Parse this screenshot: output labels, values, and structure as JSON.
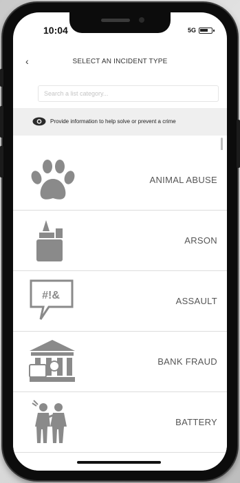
{
  "status_bar": {
    "time": "10:04",
    "signal": "5G"
  },
  "header": {
    "back_glyph": "‹",
    "title": "SELECT AN INCIDENT TYPE"
  },
  "search": {
    "placeholder": "Search a list category..."
  },
  "notice": {
    "text": "Provide information to help solve or prevent a crime",
    "icon": "eye-icon"
  },
  "incidents": [
    {
      "label": "ANIMAL ABUSE",
      "icon": "paw-icon"
    },
    {
      "label": "ARSON",
      "icon": "lighter-icon"
    },
    {
      "label": "ASSAULT",
      "icon": "speech-bubble-icon",
      "icon_text": "#!&"
    },
    {
      "label": "BANK FRAUD",
      "icon": "bank-icon"
    },
    {
      "label": "BATTERY",
      "icon": "fighting-people-icon"
    }
  ],
  "colors": {
    "icon_gray": "#8a8a8a",
    "label_gray": "#555555",
    "notice_bg": "#efefef"
  }
}
